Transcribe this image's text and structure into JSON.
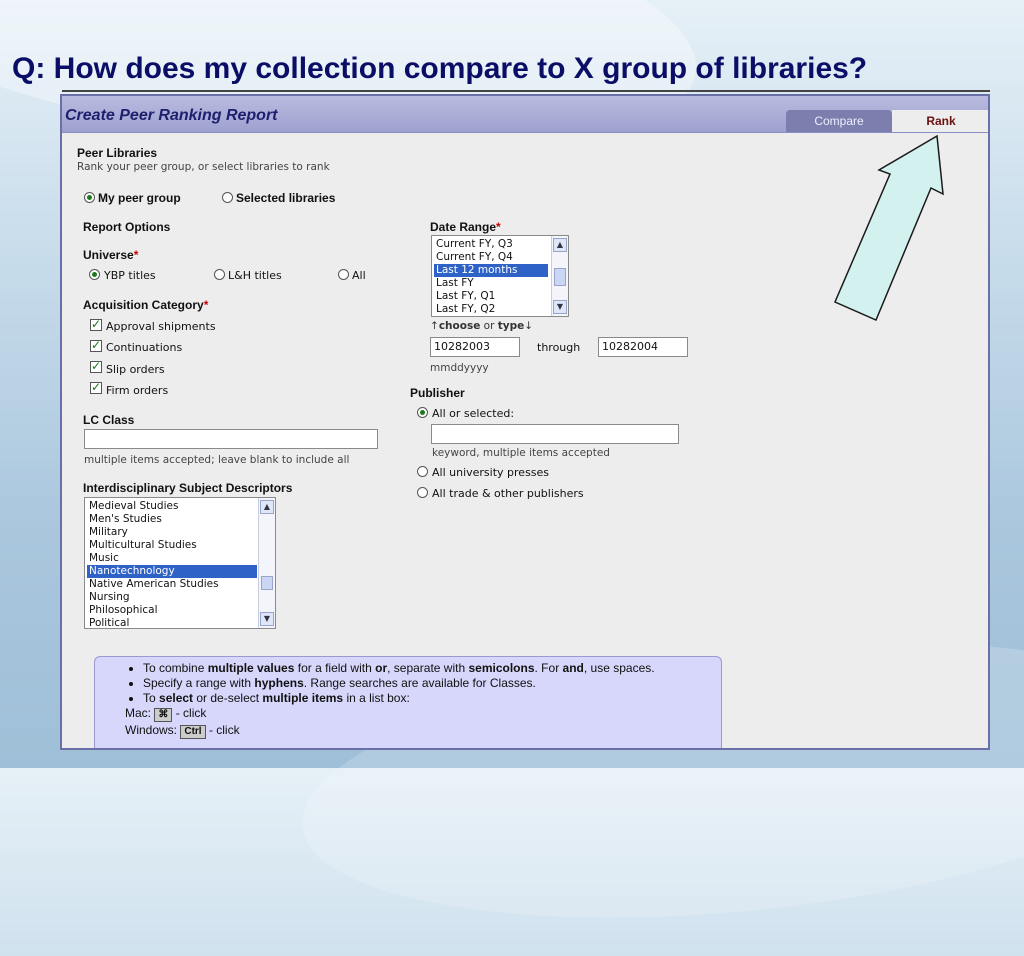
{
  "slide": {
    "title": "Q: How does my collection compare to X group of libraries?"
  },
  "app": {
    "title": "Create Peer Ranking Report",
    "tabs": [
      {
        "label": "Compare",
        "active": false
      },
      {
        "label": "Rank",
        "active": true
      }
    ]
  },
  "peer": {
    "heading": "Peer Libraries",
    "subtitle": "Rank your peer group, or select libraries to rank",
    "options": [
      "My peer group",
      "Selected libraries"
    ],
    "selected": "My peer group"
  },
  "report_options": {
    "heading": "Report Options",
    "universe": {
      "label": "Universe",
      "required_mark": "*",
      "options": [
        "YBP titles",
        "L&H titles",
        "All"
      ],
      "selected": "YBP titles"
    },
    "acquisition": {
      "label": "Acquisition Category",
      "required_mark": "*",
      "options": [
        "Approval shipments",
        "Continuations",
        "Slip orders",
        "Firm orders"
      ],
      "checked": [
        true,
        true,
        true,
        true
      ]
    },
    "lc_class": {
      "label": "LC Class",
      "value": "",
      "hint": "multiple items accepted; leave blank to include all"
    },
    "subjects": {
      "label": "Interdisciplinary Subject Descriptors",
      "items": [
        "Medieval Studies",
        "Men's Studies",
        "Military",
        "Multicultural Studies",
        "Music",
        "Nanotechnology",
        "Native American Studies",
        "Nursing",
        "Philosophical",
        "Political"
      ],
      "selected": "Nanotechnology"
    }
  },
  "date_range": {
    "label": "Date Range",
    "required_mark": "*",
    "items": [
      "Current FY, Q3",
      "Current FY, Q4",
      "Last 12 months",
      "Last FY",
      "Last FY, Q1",
      "Last FY, Q2"
    ],
    "selected": "Last 12 months",
    "choose_or_type": {
      "choose": "choose",
      "or": "or",
      "type": "type"
    },
    "from": "10282003",
    "through_label": "through",
    "to": "10282004",
    "format_hint": "mmddyyyy"
  },
  "publisher": {
    "label": "Publisher",
    "options": [
      "All or selected:",
      "All university presses",
      "All trade & other publishers"
    ],
    "selected": "All or selected:",
    "keyword_value": "",
    "keyword_hint": "keyword, multiple items accepted"
  },
  "help": {
    "lines": [
      {
        "parts": [
          "To combine ",
          "multiple values",
          " for a field with ",
          "or",
          ", separate with ",
          "semicolons",
          ". For ",
          "and",
          ", use spaces."
        ]
      },
      {
        "parts": [
          "Specify a range with ",
          "hyphens",
          ". Range searches are available for Classes."
        ]
      },
      {
        "parts": [
          "To ",
          "select",
          " or de-select ",
          "multiple items",
          " in a list box:"
        ]
      }
    ],
    "mac_label": "Mac:",
    "mac_key": "⌘",
    "mac_action": "- click",
    "win_label": "Windows:",
    "win_key": "Ctrl",
    "win_action": "- click"
  },
  "colors": {
    "arrow_fill": "#d3f2ef",
    "selection": "#2f62c6",
    "header": "#a4a7d3"
  }
}
